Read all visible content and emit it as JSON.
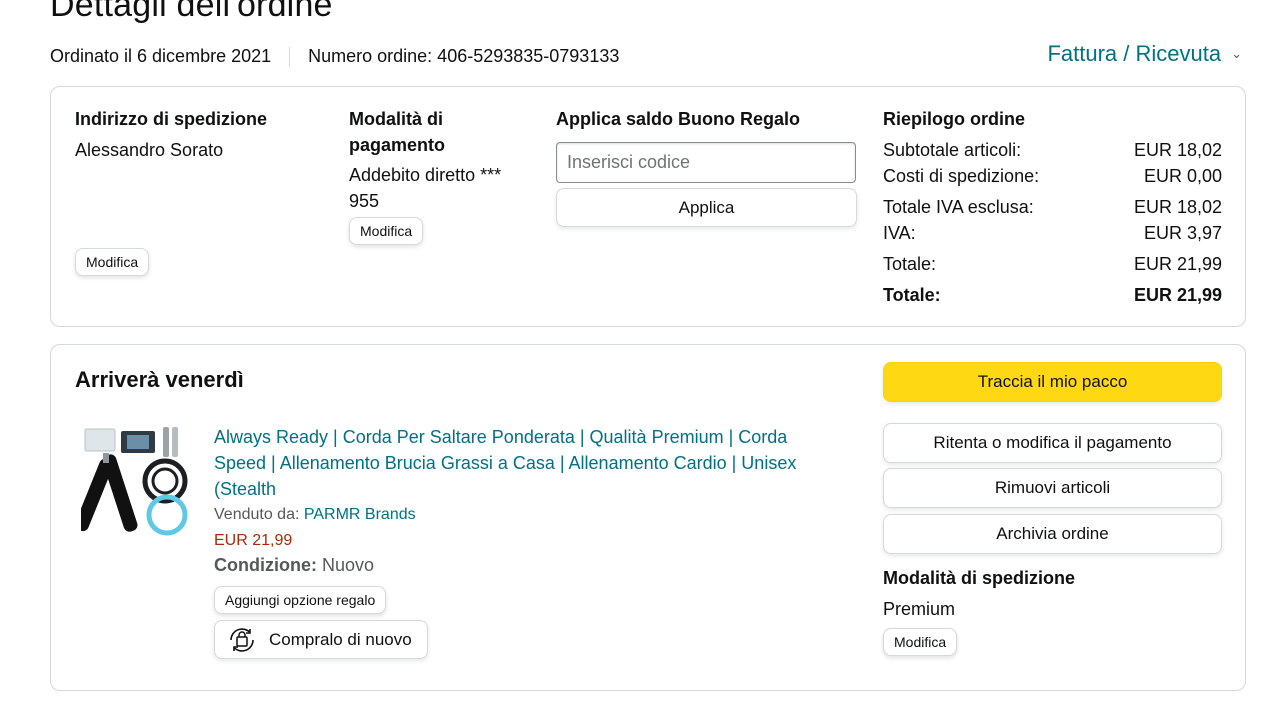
{
  "page": {
    "title": "Dettagli dell'ordine",
    "ordered_on": "Ordinato il 6 dicembre 2021",
    "order_number": "Numero ordine: 406-5293835-0793133",
    "invoice_label": "Fattura / Ricevuta"
  },
  "shipping_address": {
    "heading": "Indirizzo di spedizione",
    "name": "Alessandro Sorato",
    "edit_label": "Modifica"
  },
  "payment": {
    "heading_line1": "Modalità di",
    "heading_line2": "pagamento",
    "method_line1": "Addebito diretto ***",
    "method_line2": "955",
    "edit_label": "Modifica"
  },
  "gift_card": {
    "heading": "Applica saldo Buono Regalo",
    "placeholder": "Inserisci codice",
    "apply_label": "Applica"
  },
  "summary": {
    "heading": "Riepilogo ordine",
    "rows": [
      {
        "label": "Subtotale articoli:",
        "value": "EUR 18,02"
      },
      {
        "label": "Costi di spedizione:",
        "value": "EUR 0,00"
      },
      {
        "label": "Totale IVA esclusa:",
        "value": "EUR 18,02"
      },
      {
        "label": "IVA:",
        "value": "EUR 3,97"
      },
      {
        "label": "Totale:",
        "value": "EUR 21,99"
      },
      {
        "label": "Totale:",
        "value": "EUR 21,99"
      }
    ]
  },
  "shipment": {
    "heading": "Arriverà venerdì",
    "product": {
      "title_line1": "Always Ready | Corda Per Saltare Ponderata | Qualità Premium | Corda",
      "title_line2": "Speed | Allenamento Brucia Grassi a Casa | Allenamento Cardio | Unisex",
      "title_line3": "(Stealth",
      "sold_by_label": "Venduto da:",
      "seller": "PARMR Brands",
      "price": "EUR 21,99",
      "condition_label": "Condizione:",
      "condition_value": "Nuovo",
      "gift_option_label": "Aggiungi opzione regalo",
      "buy_again_label": "Compralo di nuovo"
    },
    "actions": {
      "track": "Traccia il mio pacco",
      "retry_payment": "Ritenta o modifica il pagamento",
      "remove_items": "Rimuovi articoli",
      "archive": "Archivia ordine"
    },
    "shipping_method": {
      "heading": "Modalità di spedizione",
      "value": "Premium",
      "edit_label": "Modifica"
    }
  },
  "colors": {
    "link": "#007185",
    "price": "#b12704",
    "primary_button": "#ffd814",
    "border": "#d5d9d9"
  },
  "icons": {
    "invoice_chevron": "chevron-down-icon",
    "buy_again": "buy-again-icon"
  }
}
